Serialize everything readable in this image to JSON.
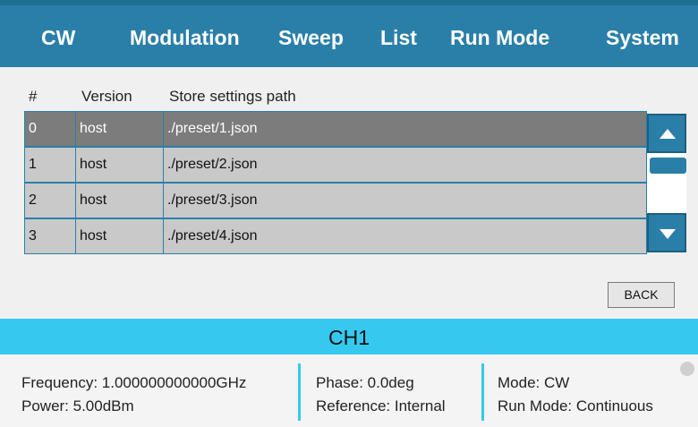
{
  "nav": {
    "tabs": [
      "CW",
      "Modulation",
      "Sweep",
      "List",
      "Run Mode",
      "System"
    ]
  },
  "table": {
    "headers": [
      "#",
      "Version",
      "Store settings path"
    ],
    "rows": [
      {
        "index": "0",
        "version": "host",
        "path": "./preset/1.json",
        "selected": true
      },
      {
        "index": "1",
        "version": "host",
        "path": "./preset/2.json",
        "selected": false
      },
      {
        "index": "2",
        "version": "host",
        "path": "./preset/3.json",
        "selected": false
      },
      {
        "index": "3",
        "version": "host",
        "path": "./preset/4.json",
        "selected": false
      }
    ]
  },
  "back_label": "BACK",
  "channel": {
    "title": "CH1",
    "frequency": "Frequency: 1.000000000000GHz",
    "power": "Power: 5.00dBm",
    "phase": "Phase: 0.0deg",
    "reference": "Reference: Internal",
    "mode": "Mode: CW",
    "run_mode": "Run Mode: Continuous"
  },
  "colors": {
    "accent": "#2a7fa8",
    "channel_bar": "#36c9f0",
    "selected_row": "#7c7c7c",
    "row": "#c9c9c9"
  },
  "icons": {
    "scroll_up": "triangle-up-icon",
    "scroll_down": "triangle-down-icon",
    "status": "status-dot-icon"
  }
}
